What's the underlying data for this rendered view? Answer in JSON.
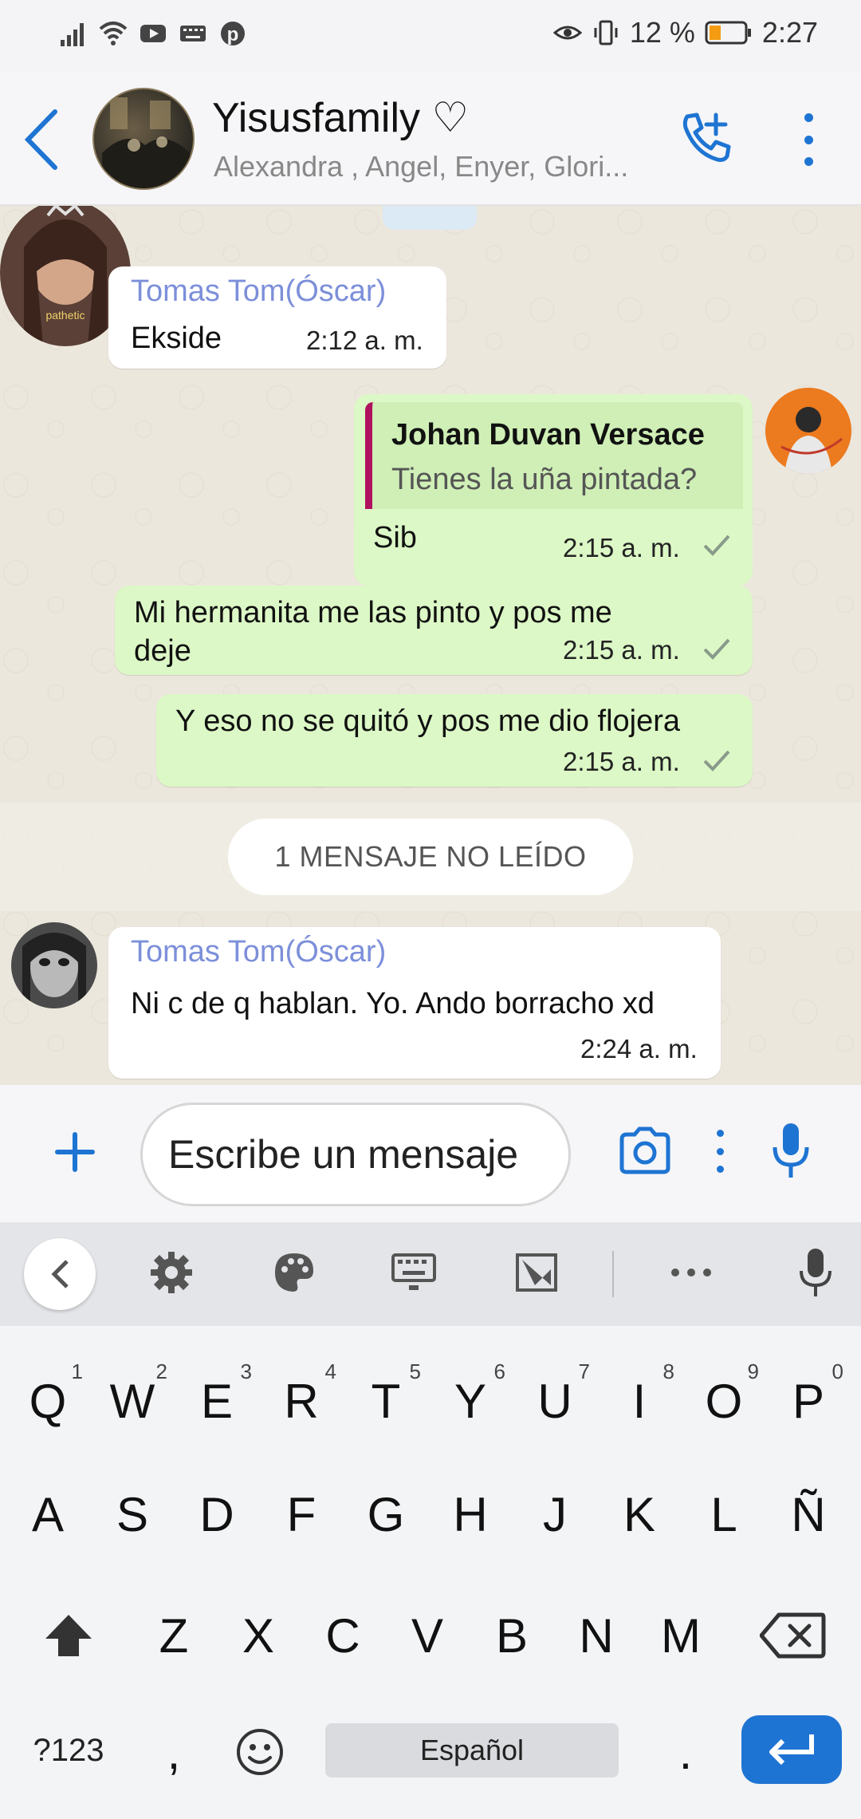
{
  "status_bar": {
    "battery_percent": "12 %",
    "time": "2:27",
    "left_icons": [
      "signal-icon",
      "wifi-icon",
      "youtube-icon",
      "keyboard-icon",
      "pinterest-icon"
    ],
    "right_icons": [
      "eye-icon",
      "vibrate-icon",
      "battery-icon"
    ]
  },
  "header": {
    "title": "Yisusfamily ♡",
    "members": "Alexandra , Angel, Enyer, Glori...",
    "accent_color": "#1e74d2"
  },
  "chat": {
    "messages": [
      {
        "direction": "in",
        "sender": "Tomas Tom(Óscar)",
        "text": "Ekside",
        "time": "2:12 a. m."
      },
      {
        "direction": "out",
        "quote_author": "Johan Duvan Versace",
        "quote_text": "Tienes la uña pintada?",
        "text": "Sib",
        "time": "2:15 a. m."
      },
      {
        "direction": "out",
        "text": "Mi hermanita me las pinto y pos me deje",
        "time": "2:15 a. m."
      },
      {
        "direction": "out",
        "text": "Y eso no se quitó y pos me dio flojera",
        "time": "2:15 a. m."
      },
      {
        "direction": "in",
        "sender": "Tomas Tom(Óscar)",
        "text": "Ni c de q hablan. Yo. Ando borracho xd",
        "time": "2:24 a. m."
      }
    ],
    "unread_label": "1 MENSAJE NO LEÍDO",
    "avatar_label": "pathetic",
    "bubble_in_color": "#ffffff",
    "bubble_out_color": "#dcf8c6",
    "sender_color": "#7c8fda"
  },
  "composer": {
    "placeholder": "Escribe un mensaje"
  },
  "keyboard": {
    "row1": [
      "Q",
      "W",
      "E",
      "R",
      "T",
      "Y",
      "U",
      "I",
      "O",
      "P"
    ],
    "row1_hints": [
      "1",
      "2",
      "3",
      "4",
      "5",
      "6",
      "7",
      "8",
      "9",
      "0"
    ],
    "row2": [
      "A",
      "S",
      "D",
      "F",
      "G",
      "H",
      "J",
      "K",
      "L",
      "Ñ"
    ],
    "row3": [
      "Z",
      "X",
      "C",
      "V",
      "B",
      "N",
      "M"
    ],
    "symbols_label": "?123",
    "comma": ",",
    "period": ".",
    "space_label": "Español"
  }
}
